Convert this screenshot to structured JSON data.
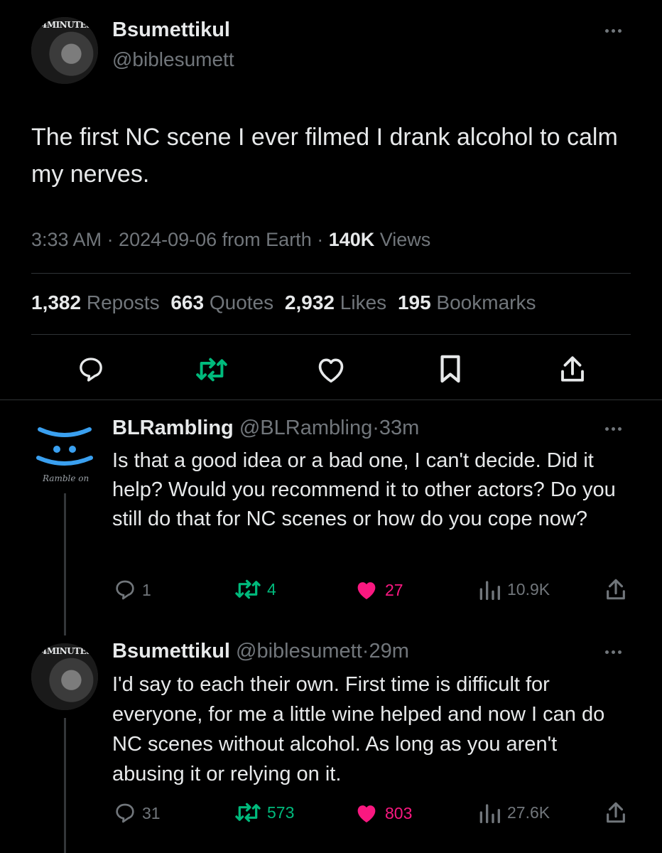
{
  "main_tweet": {
    "avatar_tag": "4MINUTES",
    "name": "Bsumettikul",
    "handle": "@biblesumett",
    "text": "The first NC scene I ever filmed I drank alcohol to calm my nerves.",
    "time": "3:33 AM · 2024-09-06 from Earth · ",
    "views_count": "140K",
    "views_label": " Views",
    "stats": [
      {
        "count": "1,382",
        "label": " Reposts"
      },
      {
        "count": "663",
        "label": " Quotes"
      },
      {
        "count": "2,932",
        "label": " Likes"
      },
      {
        "count": "195",
        "label": " Bookmarks"
      }
    ]
  },
  "replies": [
    {
      "avatar_text": "Ramble on",
      "name": "BLRambling",
      "handle": "@BLRambling",
      "time": "·33m",
      "text": "Is that a good idea or a bad one, I can't decide. Did it help? Would you recommend it to other actors? Do you still do that for NC scenes or how do you cope now?",
      "replies": "1",
      "reposts": "4",
      "likes": "27",
      "views": "10.9K"
    },
    {
      "avatar_tag": "4MINUTES",
      "name": "Bsumettikul",
      "handle": "@biblesumett",
      "time": "·29m",
      "text": "I'd say to each their own. First time is difficult for everyone, for me a little wine helped and now I can do NC scenes without alcohol. As long as you aren't abusing it or relying on it.",
      "replies": "31",
      "reposts": "573",
      "likes": "803",
      "views": "27.6K"
    }
  ],
  "colors": {
    "background": "#000000",
    "text": "#e7e9ea",
    "muted": "#71767b",
    "repost_green": "#00ba7c",
    "like_pink": "#f91880",
    "divider": "#2f3336"
  }
}
